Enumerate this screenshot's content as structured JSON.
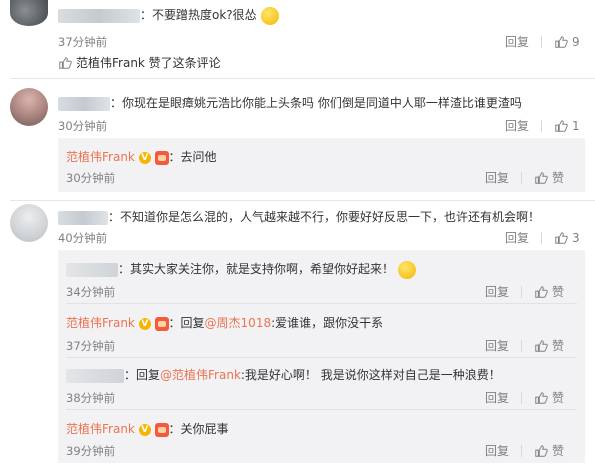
{
  "comments": [
    {
      "text": "：不要蹭热度ok?很怂",
      "time": "37分钟前",
      "reply_label": "回复",
      "like_count": "9",
      "liked_by": "范植伟Frank 赞了这条评论"
    },
    {
      "text": "：你现在是眼瘴姚元浩比你能上头条吗 你们倒是同道中人耶一样渣比谁更渣吗",
      "time": "30分钟前",
      "reply_label": "回复",
      "like_count": "1",
      "reply": {
        "author": "范植伟Frank",
        "text": "：去问他",
        "time": "30分钟前",
        "reply_label": "回复",
        "like_label": "赞"
      }
    },
    {
      "text": "：不知道你是怎么混的，人气越来越不行，你要好好反思一下，也许还有机会啊！",
      "time": "40分钟前",
      "reply_label": "回复",
      "like_count": "3",
      "replies": [
        {
          "text": "：其实大家关注你，就是支持你啊，希望你好起来！",
          "time": "34分钟前",
          "reply_label": "回复",
          "like_label": "赞"
        },
        {
          "author": "范植伟Frank",
          "text_prefix": "：回复",
          "mention": "@周杰1018",
          "text_suffix": ":爱谁谁，跟你没干系",
          "time": "37分钟前",
          "reply_label": "回复",
          "like_label": "赞"
        },
        {
          "text_prefix": "：回复",
          "mention": "@范植伟Frank",
          "text_suffix": ":我是好心啊！ 我是说你这样对自己是一种浪费！",
          "time": "38分钟前",
          "reply_label": "回复",
          "like_label": "赞"
        },
        {
          "author": "范植伟Frank",
          "text": "：关你屁事",
          "time": "39分钟前",
          "reply_label": "回复",
          "like_label": "赞"
        }
      ]
    }
  ],
  "colors": {
    "name": "#eb7350",
    "time": "#808080",
    "reply_bg": "#f2f2f5"
  }
}
